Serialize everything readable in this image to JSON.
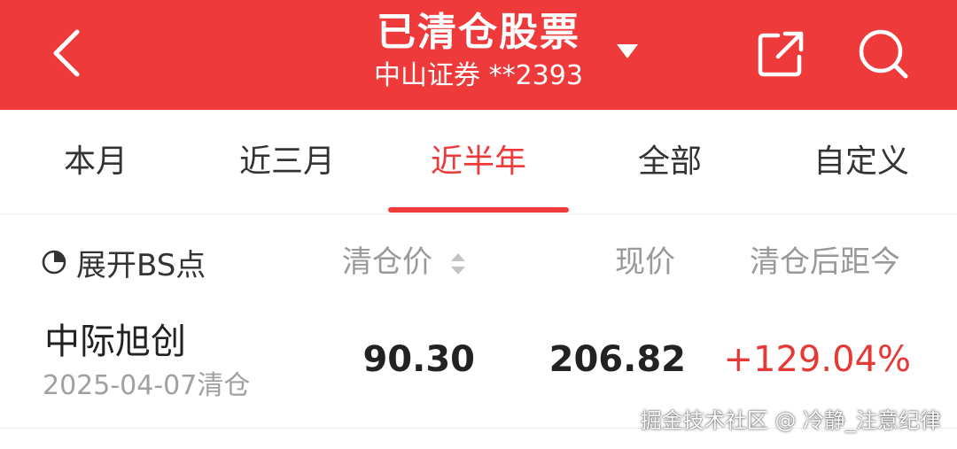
{
  "colors": {
    "brand_red": "#ee3a3a",
    "text_primary": "#222222",
    "text_secondary": "#999999",
    "positive": "#e53935"
  },
  "header": {
    "title": "已清仓股票",
    "subtitle": "中山证券 **2393",
    "back_icon": "chevron-left-icon",
    "dropdown_icon": "triangle-down-icon",
    "share_icon": "share-icon",
    "search_icon": "search-icon"
  },
  "tabs": [
    {
      "label": "本月",
      "active": false
    },
    {
      "label": "近三月",
      "active": false
    },
    {
      "label": "近半年",
      "active": true
    },
    {
      "label": "全部",
      "active": false
    },
    {
      "label": "自定义",
      "active": false
    }
  ],
  "columns": {
    "expand_bs": "展开BS点",
    "clear_price": "清仓价",
    "current_price": "现价",
    "change_since_clear": "清仓后距今"
  },
  "rows": [
    {
      "name": "中际旭创",
      "date_note": "2025-04-07清仓",
      "clear_price": "90.30",
      "current_price": "206.82",
      "change": "+129.04%"
    }
  ],
  "watermark": "掘金技术社区 @ 冷静_注意纪律"
}
